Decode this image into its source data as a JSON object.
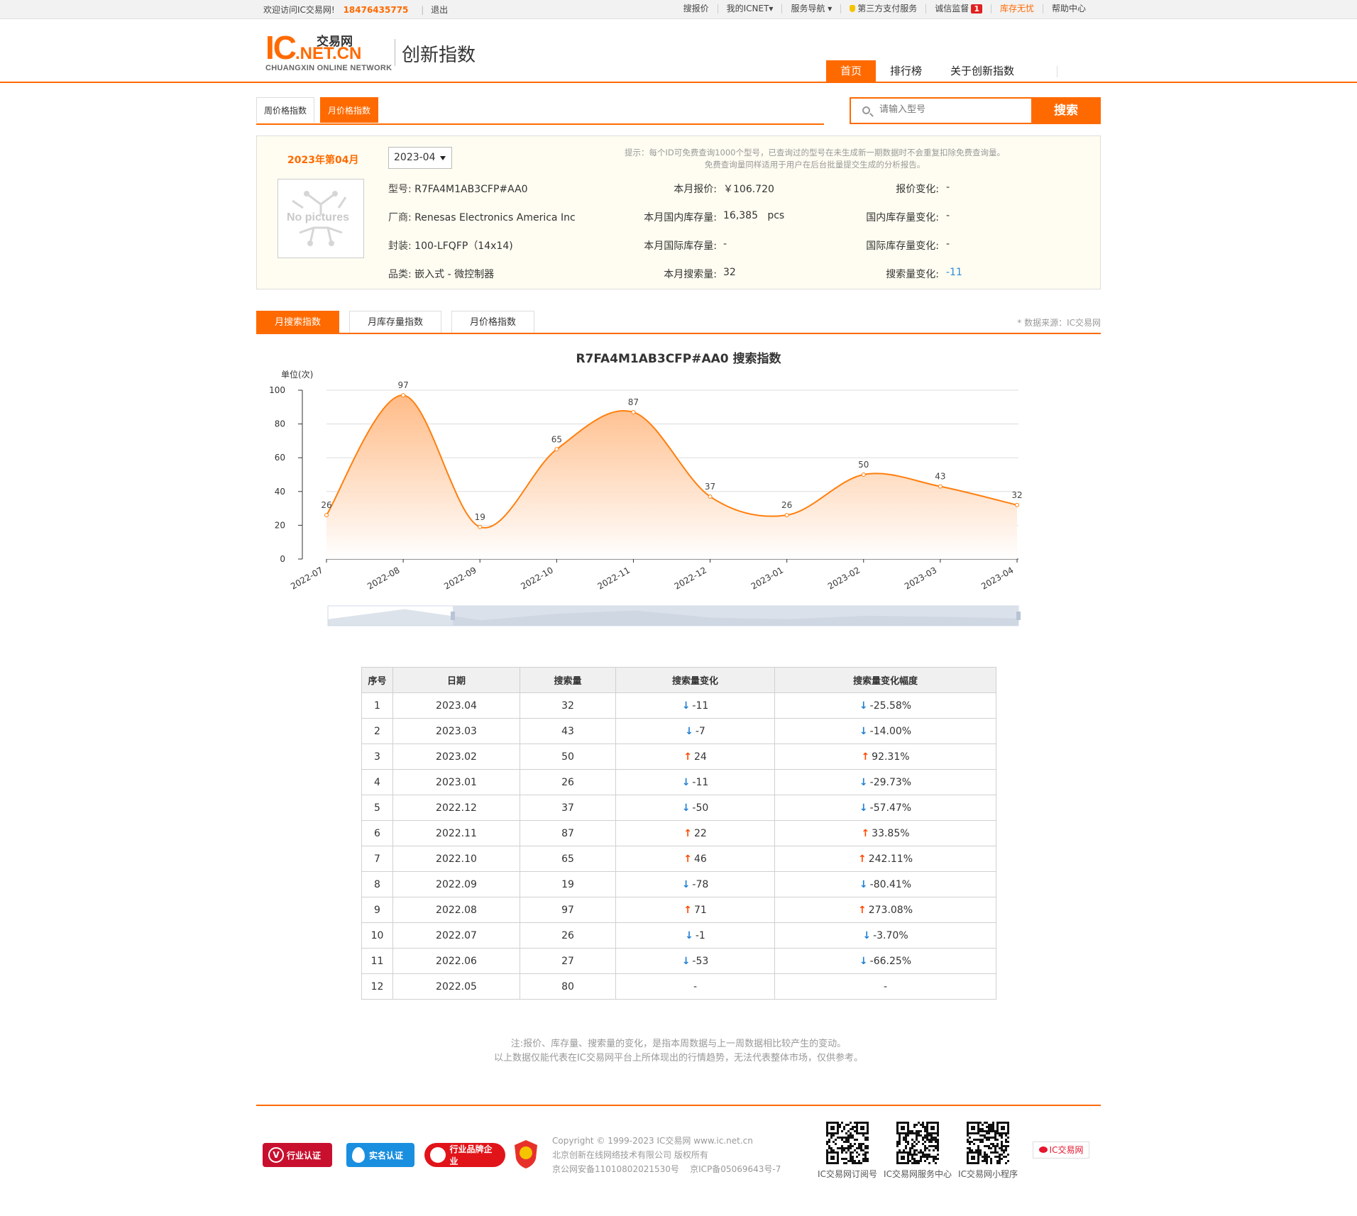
{
  "topbar": {
    "welcome": "欢迎访问IC交易网!",
    "phone": "18476435775",
    "logout": "退出",
    "links": [
      "搜报价",
      "我的ICNET▾",
      "服务导航 ▾",
      "第三方支付服务",
      "诚信监督",
      "库存无忧",
      "帮助中心"
    ],
    "notify_count": "1"
  },
  "header": {
    "logo_ic": "IC",
    "logo_net": ".NET.CN",
    "logo_cn": "交易网",
    "logo_sub": "CHUANGXIN ONLINE NETWORK",
    "site_title": "创新指数",
    "nav": [
      "首页",
      "排行榜",
      "关于创新指数"
    ]
  },
  "subtabs": [
    "周价格指数",
    "月价格指数"
  ],
  "search": {
    "placeholder": "请输入型号",
    "button": "搜索"
  },
  "info": {
    "period": "2023年第04月",
    "month": "2023-04",
    "tip_line1": "提示：每个ID可免费查询1000个型号，已查询过的型号在未生成新一期数据时不会重复扣除免费查询量。",
    "tip_line2": "免费查询量同样适用于用户在后台批量提交生成的分析报告。",
    "nopic": "No pictures",
    "model_label": "型号:",
    "model": "R7FA4M1AB3CFP#AA0",
    "maker_label": "厂商:",
    "maker": "Renesas Electronics America Inc",
    "pkg_label": "封装:",
    "pkg": "100-LFQFP（14x14)",
    "cat_label": "品类:",
    "cat": "嵌入式 - 微控制器",
    "price_label": "本月报价:",
    "price": "￥106.720",
    "dstock_label": "本月国内库存量:",
    "dstock": "16,385   pcs",
    "istock_label": "本月国际库存量:",
    "istock": "-",
    "search_label": "本月搜索量:",
    "search": "32",
    "price_chg_label": "报价变化:",
    "price_chg": "-",
    "dstock_chg_label": "国内库存量变化:",
    "dstock_chg": "-",
    "istock_chg_label": "国际库存量变化:",
    "istock_chg": "-",
    "search_chg_label": "搜索量变化:",
    "search_chg": "-11"
  },
  "chart_tabs": [
    "月搜索指数",
    "月库存量指数",
    "月价格指数"
  ],
  "source": "* 数据来源：IC交易网",
  "chart_data": {
    "type": "area",
    "title": "R7FA4M1AB3CFP#AA0 搜索指数",
    "ylabel": "单位(次)",
    "categories": [
      "2022-07",
      "2022-08",
      "2022-09",
      "2022-10",
      "2022-11",
      "2022-12",
      "2023-01",
      "2023-02",
      "2023-03",
      "2023-04"
    ],
    "values": [
      26,
      97,
      19,
      65,
      87,
      37,
      26,
      50,
      43,
      32
    ],
    "ylim": [
      0,
      100
    ],
    "yticks": [
      0,
      20,
      40,
      60,
      80,
      100
    ],
    "colors": {
      "line": "#ff7f0e",
      "fill_top": "#ffb47a",
      "fill_bottom": "#ffffff"
    },
    "grid": true
  },
  "table": {
    "headers": [
      "序号",
      "日期",
      "搜索量",
      "搜索量变化",
      "搜索量变化幅度"
    ],
    "rows": [
      [
        "1",
        "2023.04",
        "32",
        "-11",
        "-25.58%"
      ],
      [
        "2",
        "2023.03",
        "43",
        "-7",
        "-14.00%"
      ],
      [
        "3",
        "2023.02",
        "50",
        "24",
        "92.31%"
      ],
      [
        "4",
        "2023.01",
        "26",
        "-11",
        "-29.73%"
      ],
      [
        "5",
        "2022.12",
        "37",
        "-50",
        "-57.47%"
      ],
      [
        "6",
        "2022.11",
        "87",
        "22",
        "33.85%"
      ],
      [
        "7",
        "2022.10",
        "65",
        "46",
        "242.11%"
      ],
      [
        "8",
        "2022.09",
        "19",
        "-78",
        "-80.41%"
      ],
      [
        "9",
        "2022.08",
        "97",
        "71",
        "273.08%"
      ],
      [
        "10",
        "2022.07",
        "26",
        "-1",
        "-3.70%"
      ],
      [
        "11",
        "2022.06",
        "27",
        "-53",
        "-66.25%"
      ],
      [
        "12",
        "2022.05",
        "80",
        "-",
        "-"
      ]
    ]
  },
  "note": {
    "line1": "注:报价、库存量、搜索量的变化，是指本周数据与上一周数据相比较产生的变动。",
    "line2": "以上数据仅能代表在IC交易网平台上所体现出的行情趋势，无法代表整体市场，仅供参考。"
  },
  "footer": {
    "badges": [
      "行业认证",
      "实名认证",
      "行业品牌企业"
    ],
    "copyright1": "Copyright © 1999-2023 IC交易网 www.ic.net.cn",
    "copyright2": "北京创新在线网络技术有限公司 版权所有",
    "copyright3": "京公网安备11010802021530号    京ICP备05069643号-7",
    "qr_labels": [
      "IC交易网订阅号",
      "IC交易网服务中心",
      "IC交易网小程序"
    ],
    "weibo": "IC交易网"
  }
}
